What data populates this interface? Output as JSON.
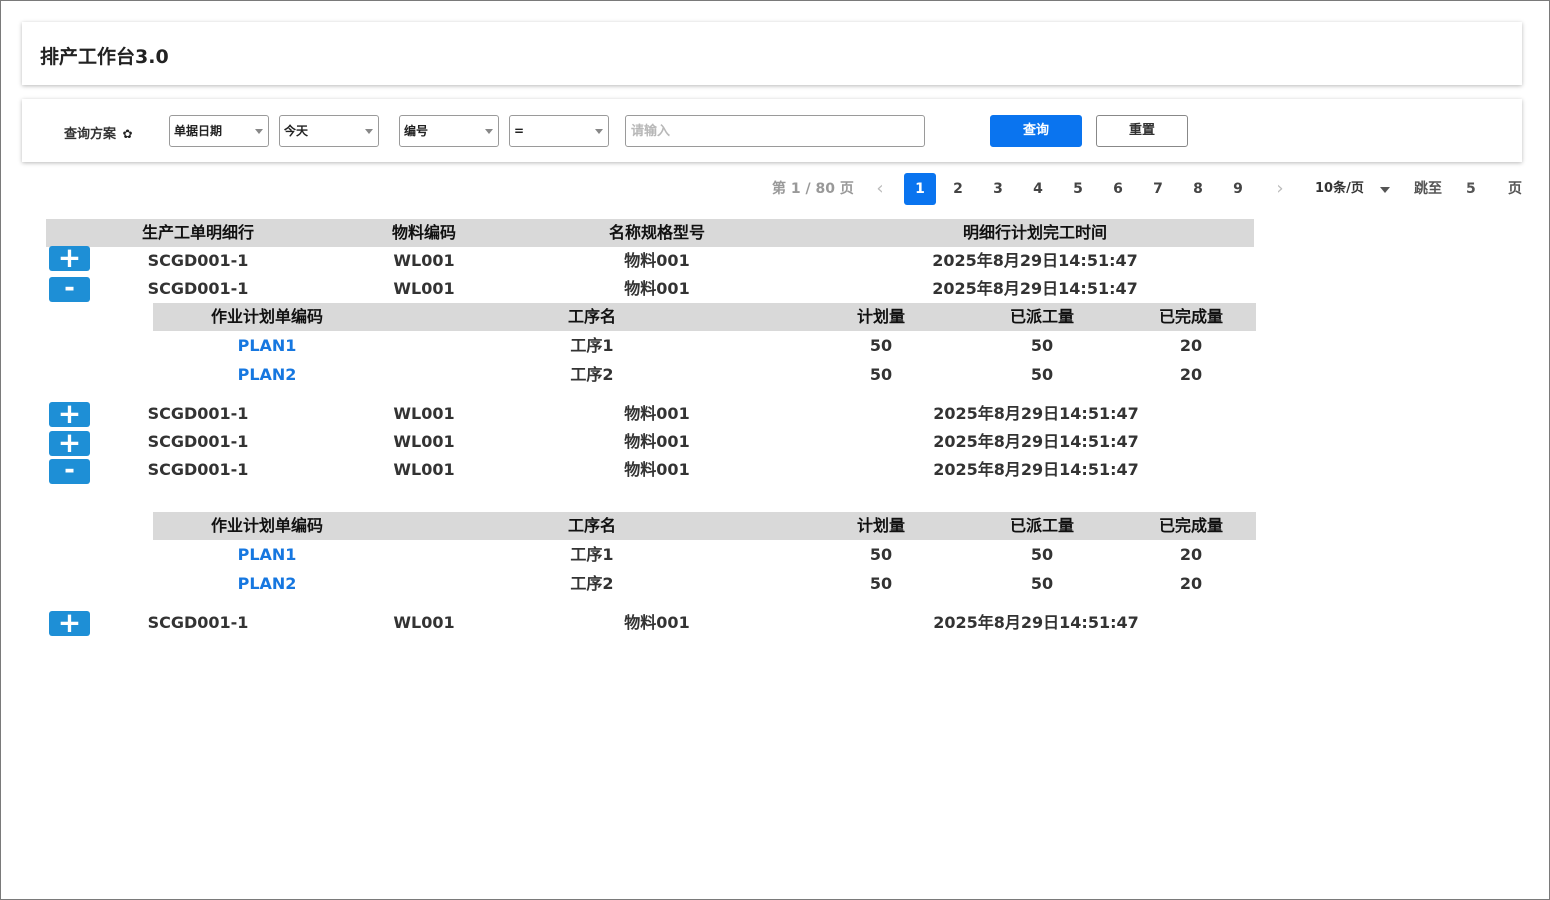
{
  "header": {
    "title": "排产工作台3.0"
  },
  "query": {
    "scheme_label": "查询方案",
    "field1": "单据日期",
    "value1": "今天",
    "field2": "编号",
    "operator": "=",
    "input_placeholder": "请输入",
    "search_label": "查询",
    "reset_label": "重置"
  },
  "pager": {
    "total_label": "第 1 / 80 页",
    "prev_icon": "chevron-left-icon",
    "next_icon": "chevron-right-icon",
    "pages": [
      "1",
      "2",
      "3",
      "4",
      "5",
      "6",
      "7",
      "8",
      "9"
    ],
    "current": "1",
    "page_size": "10条/页",
    "jump_label": "跳至",
    "jump_value": "5",
    "jump_unit": "页",
    "accent": "#0a74ef"
  },
  "main_table": {
    "columns": [
      "生产工单明细行",
      "物料编码",
      "名称规格型号",
      "明细行计划完工时间"
    ],
    "rows": [
      {
        "toggle": "+",
        "cells": [
          "SCGD001-1",
          "WL001",
          "物料001",
          "2025年8月29日14:51:47"
        ]
      },
      {
        "toggle": "-",
        "cells": [
          "SCGD001-1",
          "WL001",
          "物料001",
          "2025年8月29日14:51:47"
        ]
      },
      {
        "toggle": "+",
        "cells": [
          "SCGD001-1",
          "WL001",
          "物料001",
          "2025年8月29日14:51:47"
        ]
      },
      {
        "toggle": "+",
        "cells": [
          "SCGD001-1",
          "WL001",
          "物料001",
          "2025年8月29日14:51:47"
        ]
      },
      {
        "toggle": "-",
        "cells": [
          "SCGD001-1",
          "WL001",
          "物料001",
          "2025年8月29日14:51:47"
        ]
      },
      {
        "toggle": "+",
        "cells": [
          "SCGD001-1",
          "WL001",
          "物料001",
          "2025年8月29日14:51:47"
        ]
      }
    ]
  },
  "sub_table": {
    "columns": [
      "作业计划单编码",
      "工序名",
      "计划量",
      "已派工量",
      "已完成量"
    ],
    "groups": [
      [
        [
          "PLAN1",
          "工序1",
          "50",
          "50",
          "20"
        ],
        [
          "PLAN2",
          "工序2",
          "50",
          "50",
          "20"
        ]
      ],
      [
        [
          "PLAN1",
          "工序1",
          "50",
          "50",
          "20"
        ],
        [
          "PLAN2",
          "工序2",
          "50",
          "50",
          "20"
        ]
      ]
    ]
  },
  "colors": {
    "toggle": "#1e8fd6",
    "link": "#1677e0",
    "header_bg": "#d9d9d9"
  }
}
